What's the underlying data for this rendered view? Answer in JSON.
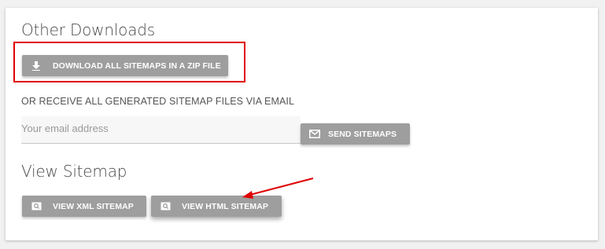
{
  "downloads": {
    "title": "Other Downloads",
    "zip_button_label": "DOWNLOAD ALL SITEMAPS IN A ZIP FILE",
    "zip_button_icon": "download-icon"
  },
  "email": {
    "caption": "OR RECEIVE ALL GENERATED SITEMAP FILES VIA EMAIL",
    "placeholder": "Your email address",
    "value": "",
    "send_button_label": "SEND SITEMAPS",
    "send_button_icon": "envelope-icon"
  },
  "view": {
    "title": "View Sitemap",
    "xml_button_label": "VIEW XML SITEMAP",
    "html_button_label": "VIEW HTML SITEMAP",
    "button_icon": "search-page-icon"
  },
  "colors": {
    "button_bg": "#9e9e9e",
    "annotation": "#e00000"
  }
}
